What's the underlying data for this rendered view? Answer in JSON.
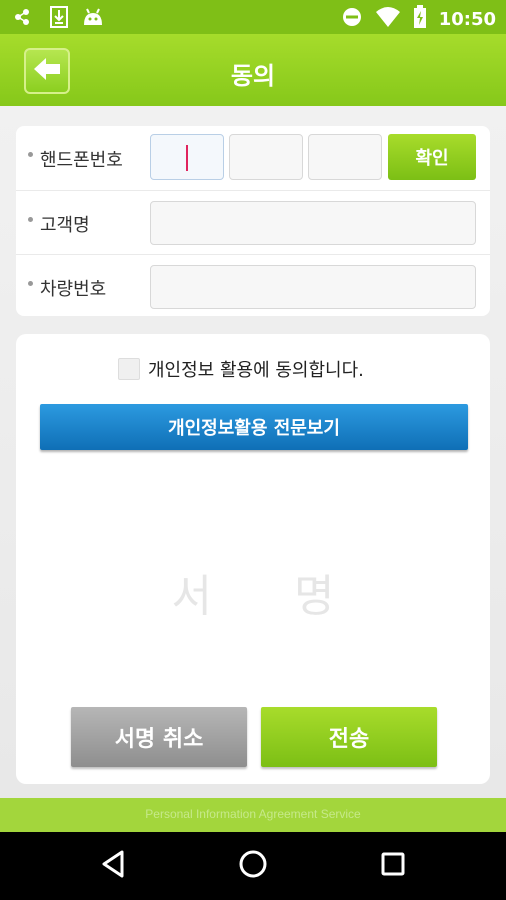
{
  "status_bar": {
    "time": "10:50",
    "left_icons": [
      "notification-dots-icon",
      "download-icon",
      "android-icon"
    ],
    "right_icons": [
      "do-not-disturb-icon",
      "wifi-icon",
      "battery-charging-icon"
    ]
  },
  "app_bar": {
    "title": "동의",
    "back_icon": "arrow-left-icon"
  },
  "form": {
    "phone_label": "핸드폰번호",
    "phone_parts": [
      "",
      "",
      ""
    ],
    "confirm_label": "확인",
    "customer_label": "고객명",
    "customer_value": "",
    "vehicle_label": "차량번호",
    "vehicle_value": ""
  },
  "agreement": {
    "checkbox_checked": false,
    "checkbox_label": "개인정보 활용에 동의합니다.",
    "fulltext_button": "개인정보활용 전문보기",
    "signature_watermark": "서 명",
    "cancel_sign_button": "서명 취소",
    "send_button": "전송"
  },
  "footer": {
    "text": "Personal Information Agreement Service"
  },
  "colors": {
    "brand_green": "#8cc820",
    "status_green": "#7fbf17",
    "blue_button": "#1a80c8",
    "gray_button": "#a0a0a0"
  },
  "nav_bar": {
    "icons": [
      "back-triangle-icon",
      "home-circle-icon",
      "recents-square-icon"
    ]
  }
}
